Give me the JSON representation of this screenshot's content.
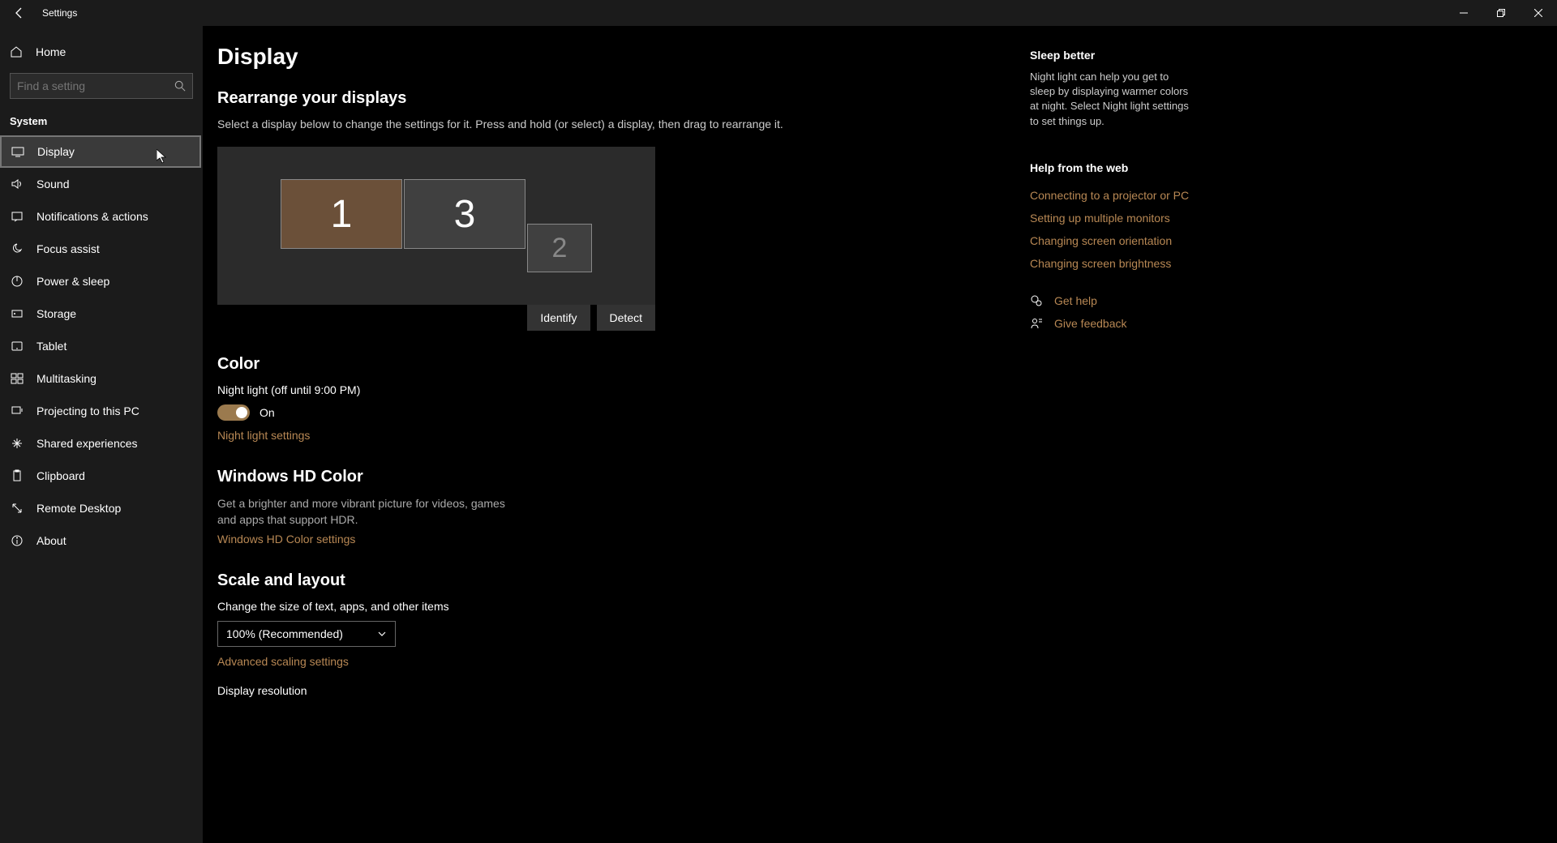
{
  "window": {
    "title": "Settings"
  },
  "sidebar": {
    "home": "Home",
    "search_placeholder": "Find a setting",
    "category": "System",
    "items": [
      {
        "label": "Display"
      },
      {
        "label": "Sound"
      },
      {
        "label": "Notifications & actions"
      },
      {
        "label": "Focus assist"
      },
      {
        "label": "Power & sleep"
      },
      {
        "label": "Storage"
      },
      {
        "label": "Tablet"
      },
      {
        "label": "Multitasking"
      },
      {
        "label": "Projecting to this PC"
      },
      {
        "label": "Shared experiences"
      },
      {
        "label": "Clipboard"
      },
      {
        "label": "Remote Desktop"
      },
      {
        "label": "About"
      }
    ]
  },
  "main": {
    "title": "Display",
    "rearrange": {
      "heading": "Rearrange your displays",
      "desc": "Select a display below to change the settings for it. Press and hold (or select) a display, then drag to rearrange it.",
      "monitors": {
        "m1": "1",
        "m2": "2",
        "m3": "3"
      },
      "identify": "Identify",
      "detect": "Detect"
    },
    "color": {
      "heading": "Color",
      "night_light_label": "Night light (off until 9:00 PM)",
      "toggle_state": "On",
      "settings_link": "Night light settings"
    },
    "hdr": {
      "heading": "Windows HD Color",
      "desc": "Get a brighter and more vibrant picture for videos, games and apps that support HDR.",
      "settings_link": "Windows HD Color settings"
    },
    "scale": {
      "heading": "Scale and layout",
      "size_label": "Change the size of text, apps, and other items",
      "size_value": "100% (Recommended)",
      "advanced_link": "Advanced scaling settings",
      "resolution_label": "Display resolution"
    }
  },
  "right": {
    "sleep_title": "Sleep better",
    "sleep_desc": "Night light can help you get to sleep by displaying warmer colors at night. Select Night light settings to set things up.",
    "help_title": "Help from the web",
    "links": [
      "Connecting to a projector or PC",
      "Setting up multiple monitors",
      "Changing screen orientation",
      "Changing screen brightness"
    ],
    "get_help": "Get help",
    "feedback": "Give feedback"
  }
}
